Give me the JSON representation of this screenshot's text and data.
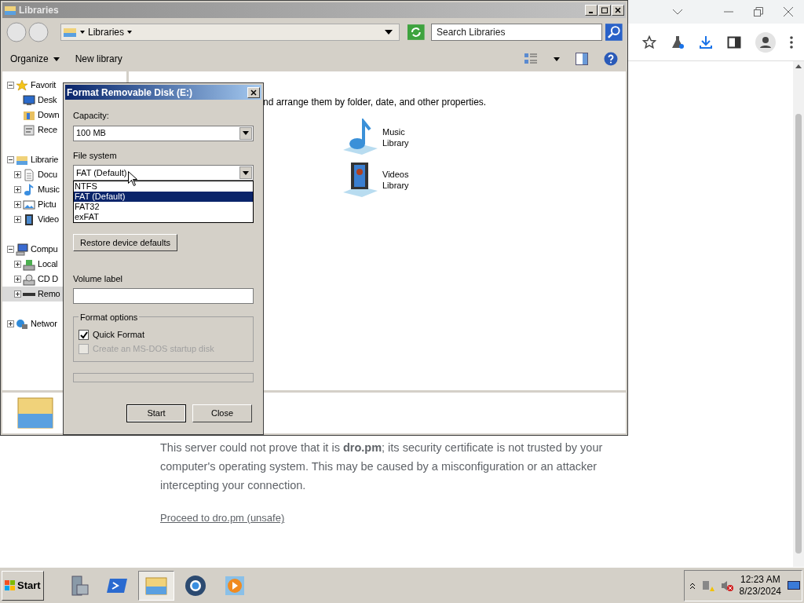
{
  "browser": {
    "paragraph": "This server could not prove that it is **dro.pm**; its security certificate is not trusted by your computer's operating system. This may be caused by a misconfiguration or an attacker intercepting your connection.",
    "link": "Proceed to dro.pm (unsafe)"
  },
  "explorer": {
    "title": "Libraries",
    "address": "Libraries",
    "search": {
      "placeholder": "Search Libraries"
    },
    "organize": "Organize",
    "new_library": "New library",
    "nav": [
      {
        "label": "Favorit",
        "kind": "star",
        "expanded": true,
        "selected": false,
        "children": [
          {
            "label": "Desk",
            "kind": "desktop",
            "selected": false
          },
          {
            "label": "Down",
            "kind": "downloads",
            "selected": false
          },
          {
            "label": "Rece",
            "kind": "recent",
            "selected": false
          }
        ]
      },
      {
        "label": "Librarie",
        "kind": "library",
        "expanded": true,
        "selected": false,
        "children": [
          {
            "label": "Docu",
            "kind": "document",
            "expanded": false,
            "selected": false
          },
          {
            "label": "Music",
            "kind": "music",
            "expanded": false,
            "selected": false
          },
          {
            "label": "Pictu",
            "kind": "picture",
            "expanded": false,
            "selected": false
          },
          {
            "label": "Video",
            "kind": "video",
            "expanded": false,
            "selected": false
          }
        ]
      },
      {
        "label": "Compu",
        "kind": "computer",
        "expanded": true,
        "selected": false,
        "children": [
          {
            "label": "Local",
            "kind": "disk",
            "expanded": false,
            "selected": false
          },
          {
            "label": "CD D",
            "kind": "cd",
            "expanded": false,
            "selected": false
          },
          {
            "label": "Remo",
            "kind": "removable",
            "expanded": false,
            "selected": true
          }
        ]
      },
      {
        "label": "Networ",
        "kind": "network",
        "expanded": false,
        "selected": false
      }
    ],
    "description": "nd arrange them by folder, date, and other properties.",
    "libraries": [
      {
        "name": "Music Library",
        "kind": "music"
      },
      {
        "name": "Videos Library",
        "kind": "video"
      }
    ]
  },
  "dialog": {
    "title": "Format Removable Disk (E:)",
    "capacity_label": "Capacity:",
    "capacity": "100 MB",
    "file_system_label": "File system",
    "file_system": "FAT (Default)",
    "file_system_options": [
      {
        "label": "NTFS",
        "selected": false
      },
      {
        "label": "FAT (Default)",
        "selected": true
      },
      {
        "label": "FAT32",
        "selected": false
      },
      {
        "label": "exFAT",
        "selected": false
      }
    ],
    "restore_button": "Restore device defaults",
    "volume_label_label": "Volume label",
    "format_options": {
      "title": "Format options",
      "options": [
        {
          "label": "Quick Format",
          "checked": true,
          "disabled": false
        },
        {
          "label": "Create an MS-DOS startup disk",
          "checked": false,
          "disabled": true
        }
      ]
    },
    "progress": {
      "level": 0
    },
    "buttons": [
      "Start",
      "Close"
    ]
  },
  "taskbar": {
    "start": "Start",
    "apps": [
      {
        "kind": "server",
        "active": false
      },
      {
        "kind": "shell",
        "active": false
      },
      {
        "kind": "explorer",
        "active": true
      },
      {
        "kind": "browser",
        "active": false
      },
      {
        "kind": "media",
        "active": false
      }
    ],
    "clock": {
      "time": "12:23 AM",
      "date": "8/23/2024"
    }
  }
}
